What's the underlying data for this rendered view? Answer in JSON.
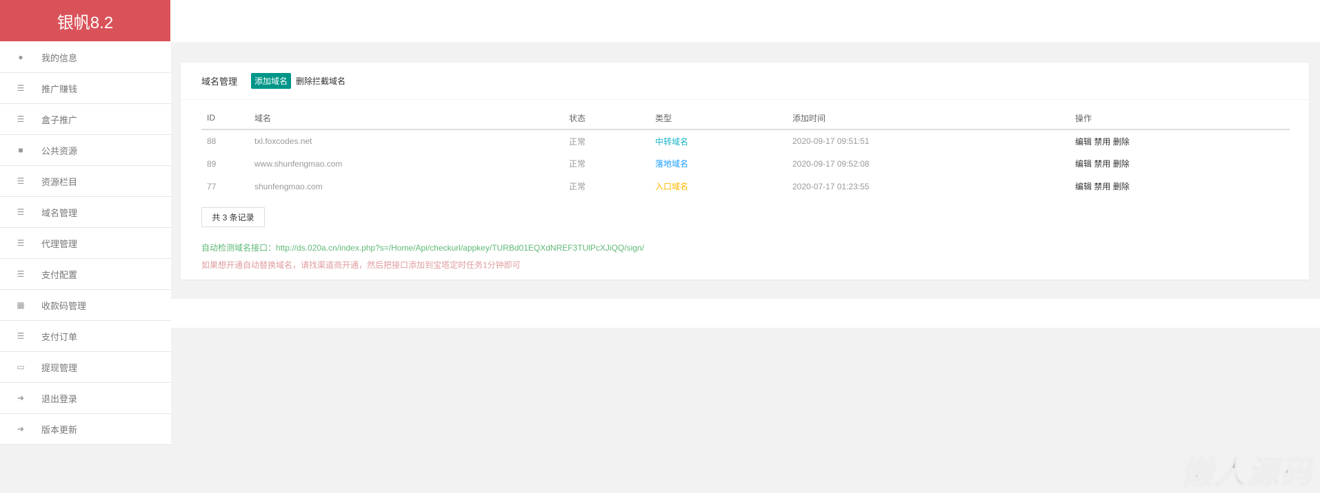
{
  "app": {
    "title": "银帆8.2"
  },
  "sidebar": {
    "items": [
      {
        "label": "我的信息",
        "icon": "user-icon"
      },
      {
        "label": "推广赚钱",
        "icon": "list-icon"
      },
      {
        "label": "盒子推广",
        "icon": "list-icon"
      },
      {
        "label": "公共资源",
        "icon": "video-camera-icon"
      },
      {
        "label": "资源栏目",
        "icon": "list-icon"
      },
      {
        "label": "域名管理",
        "icon": "list-icon"
      },
      {
        "label": "代理管理",
        "icon": "list-ul-icon"
      },
      {
        "label": "支付配置",
        "icon": "list-ul-icon"
      },
      {
        "label": "收款码管理",
        "icon": "qrcode-icon"
      },
      {
        "label": "支付订单",
        "icon": "list-ul-icon"
      },
      {
        "label": "提现管理",
        "icon": "money-icon"
      },
      {
        "label": "退出登录",
        "icon": "sign-in-icon"
      },
      {
        "label": "版本更新",
        "icon": "sign-in-icon"
      }
    ]
  },
  "card": {
    "title": "域名管理",
    "add_label": "添加域名",
    "delete_blocked_label": "删除拦截域名"
  },
  "table": {
    "headers": [
      "ID",
      "域名",
      "状态",
      "类型",
      "添加时间",
      "操作"
    ],
    "rows": [
      {
        "id": "88",
        "domain": "txl.foxcodes.net",
        "status": "正常",
        "type": "中转域名",
        "type_color": "#1ab4c8",
        "time": "2020-09-17 09:51:51"
      },
      {
        "id": "89",
        "domain": "www.shunfengmao.com",
        "status": "正常",
        "type": "落地域名",
        "type_color": "#1e9fff",
        "time": "2020-09-17 09:52:08"
      },
      {
        "id": "77",
        "domain": "shunfengmao.com",
        "status": "正常",
        "type": "入口域名",
        "type_color": "#ffb800",
        "time": "2020-07-17 01:23:55"
      }
    ],
    "actions": {
      "edit": "编辑",
      "disable": "禁用",
      "delete": "删除"
    }
  },
  "count_label": "共 3 条记录",
  "notes": {
    "api": "自动检测域名接口：http://ds.020a.cn/index.php?s=/Home/Api/checkurl/appkey/TURBd01EQXdNREF3TUlPcXJiQQ/sign/",
    "tip": "如果想开通自动替换域名，请找渠道商开通，然后把接口添加到宝塔定时任务1分钟即可"
  },
  "watermark": "懒人源码"
}
